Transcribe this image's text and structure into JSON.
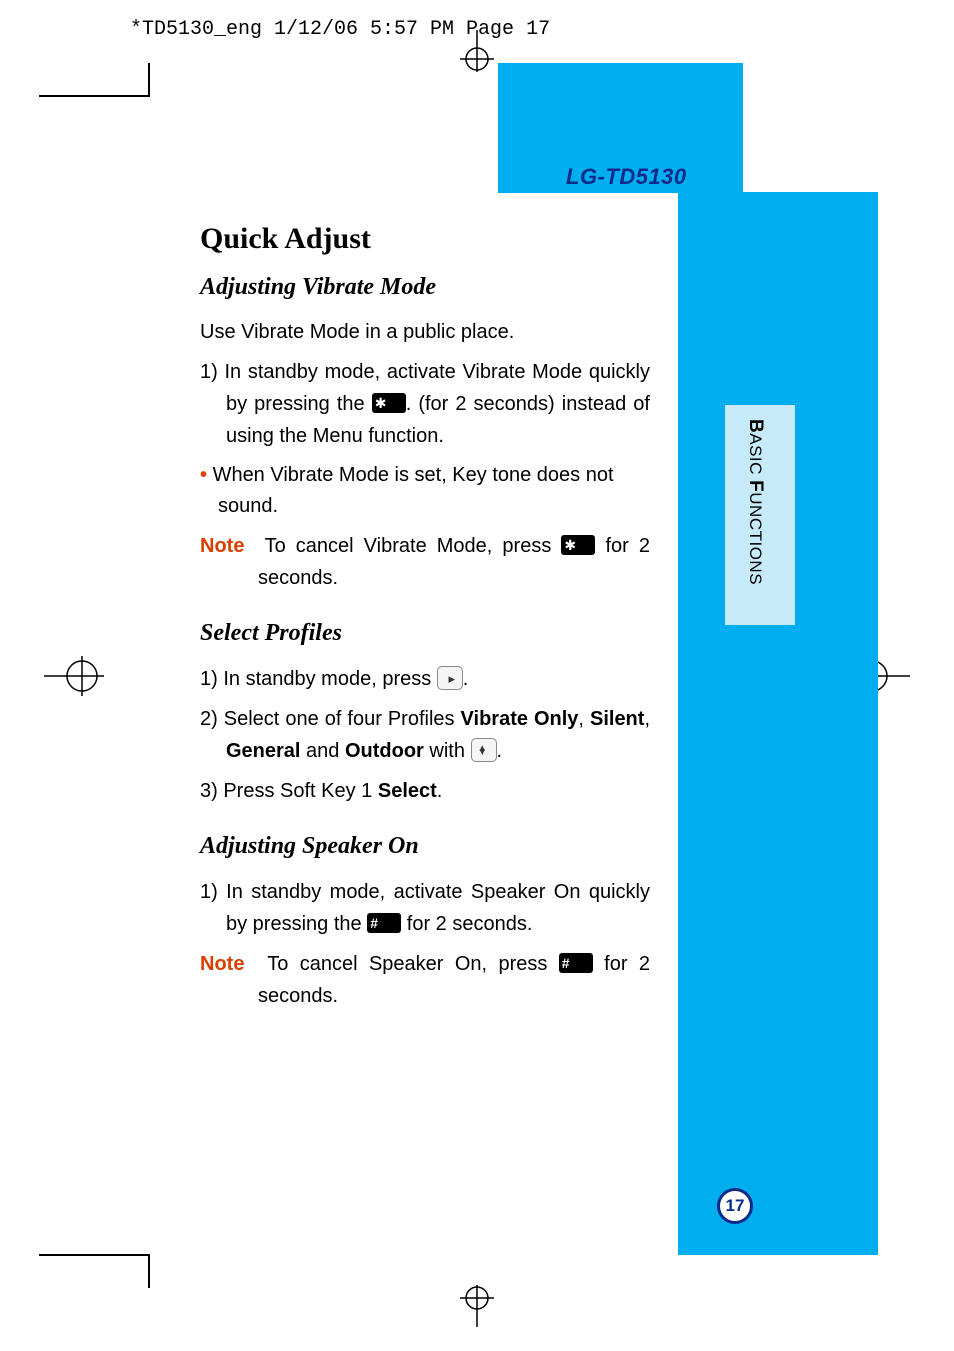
{
  "print_meta": "*TD5130_eng  1/12/06  5:57 PM  Page 17",
  "model": "LG-TD5130",
  "side_label_b1": "B",
  "side_label_r1": "ASIC",
  "side_label_b2": "F",
  "side_label_r2": "UNCTIONS",
  "page_number": "17",
  "h1": "Quick Adjust",
  "sec1": {
    "title": "Adjusting Vibrate Mode",
    "intro": "Use Vibrate Mode in a public place.",
    "step1_a": "1) In standby mode, activate Vibrate Mode quickly by pressing the ",
    "step1_b": ". (for 2 seconds) instead of using the Menu function.",
    "bullet": "When Vibrate Mode is set, Key tone does not sound.",
    "note_label": "Note",
    "note_a": "To cancel Vibrate Mode, press ",
    "note_b": " for 2 seconds."
  },
  "sec2": {
    "title": "Select Profiles",
    "step1_a": "1) In standby mode, press ",
    "step1_b": ".",
    "step2_a": "2) Select one of four Profiles ",
    "p_vibrate": "Vibrate Only",
    "comma1": ", ",
    "p_silent": "Silent",
    "comma2": ", ",
    "p_general": "General",
    "and": " and ",
    "p_outdoor": "Outdoor",
    "with": " with ",
    "step2_b": ".",
    "step3_a": "3) Press Soft Key 1 ",
    "select": "Select",
    "step3_b": "."
  },
  "sec3": {
    "title": "Adjusting Speaker On",
    "step1_a": "1) In standby mode, activate Speaker On quickly by pressing the ",
    "step1_b": " for 2 seconds.",
    "note_label": "Note",
    "note_a": "To cancel Speaker On, press ",
    "note_b": " for 2 seconds."
  }
}
